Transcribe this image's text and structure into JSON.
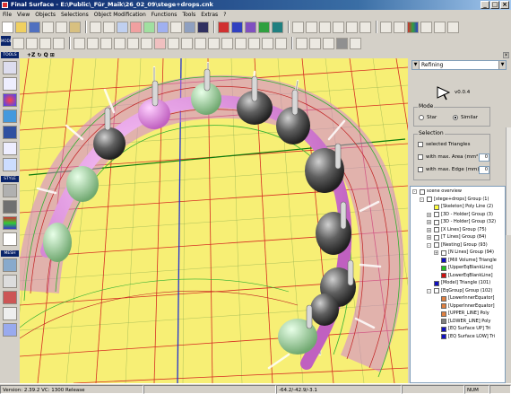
{
  "window": {
    "title": "Final Surface - E:\\Public\\_Für_Maik\\26_02_09\\stege+drops.cnk"
  },
  "menu": [
    "File",
    "View",
    "Objects",
    "Selections",
    "Object Modification",
    "Functions",
    "Tools",
    "Extras",
    "?"
  ],
  "toolbar_labels": {
    "mode": "MODE",
    "tools": "TOOLS",
    "style": "STYLE",
    "mesh": "MESH"
  },
  "viewport_header": {
    "glyphs": "+Z ↻ Q ⊞"
  },
  "right_panel": {
    "dropdown_value": "Refining",
    "version": "v0.0.4",
    "mode_title": "Mode",
    "mode_options": [
      "Star",
      "Similar"
    ],
    "mode_selected": "Similar",
    "selection_title": "Selection",
    "selection_items": [
      {
        "label": "selected Triangles",
        "spin": ""
      },
      {
        "label": "with max. Area (mm²)",
        "spin": "0"
      },
      {
        "label": "with max. Edge (mm)",
        "spin": "0"
      }
    ]
  },
  "tree": [
    {
      "label": "scene overview",
      "level": 0,
      "pm": "-",
      "color": null
    },
    {
      "label": "[stege+drops] Group (1)",
      "level": 1,
      "pm": "-",
      "color": null
    },
    {
      "label": "[Skeleton] Poly Line (2)",
      "level": 2,
      "pm": "",
      "color": "#ffff40"
    },
    {
      "label": "[3D - Holder] Group (3)",
      "level": 2,
      "pm": "+",
      "color": "#ffffff"
    },
    {
      "label": "[3D - Holder] Group (32)",
      "level": 2,
      "pm": "+",
      "color": "#ffffff"
    },
    {
      "label": "[X Lines] Group (75)",
      "level": 2,
      "pm": "+",
      "color": "#ffffff"
    },
    {
      "label": "[T Lines] Group (84)",
      "level": 2,
      "pm": "+",
      "color": "#ffffff"
    },
    {
      "label": "[Nesting] Group (93)",
      "level": 2,
      "pm": "-",
      "color": null
    },
    {
      "label": "[N Lines] Group (94)",
      "level": 3,
      "pm": "+",
      "color": "#ffffff"
    },
    {
      "label": "[Mill Volume] Triangle",
      "level": 3,
      "pm": "",
      "color": "#1010c0"
    },
    {
      "label": "[UpperEqBlankLine]",
      "level": 3,
      "pm": "",
      "color": "#20c020"
    },
    {
      "label": "[LowerEqBlankLine]",
      "level": 3,
      "pm": "",
      "color": "#d01010"
    },
    {
      "label": "[Model] Triangle (101)",
      "level": 2,
      "pm": "",
      "color": "#1010c0"
    },
    {
      "label": "[EqGroup] Group (102)",
      "level": 2,
      "pm": "-",
      "color": null
    },
    {
      "label": "[LowerInnerEquator]",
      "level": 3,
      "pm": "",
      "color": "#e08040"
    },
    {
      "label": "[UpperInnerEquator]",
      "level": 3,
      "pm": "",
      "color": "#e08040"
    },
    {
      "label": "[UPPER_LINE] Poly",
      "level": 3,
      "pm": "",
      "color": "#e08040"
    },
    {
      "label": "[LOWER_LINE] Poly",
      "level": 3,
      "pm": "",
      "color": "#808080"
    },
    {
      "label": "[EQ Surface UP] Tri",
      "level": 3,
      "pm": "",
      "color": "#1010c0"
    },
    {
      "label": "[EQ Surface LOW] Tri",
      "level": 3,
      "pm": "",
      "color": "#1010c0"
    }
  ],
  "status": {
    "version": "Version: 2.39.2 VC: 1300 Release",
    "coords": "-64.2/-42.9/-3.1",
    "num": "NUM"
  },
  "colors": {
    "viewport_bg": "#f7ef75",
    "grid_red": "#d21a1a",
    "grid_dark": "#2a6e2a",
    "selection_title": "#0a246a"
  }
}
